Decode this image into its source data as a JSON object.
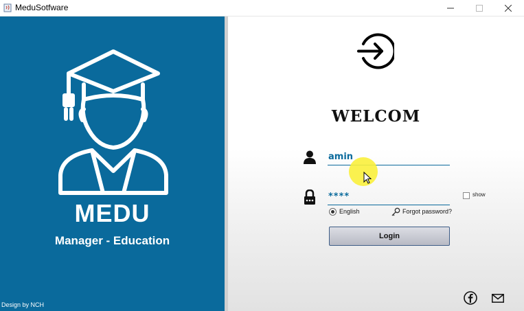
{
  "window": {
    "title": "MeduSotfware",
    "controls": [
      "minimize",
      "maximize",
      "close"
    ]
  },
  "branding": {
    "icon": "graduate-icon",
    "name": "MEDU",
    "tagline": "Manager - Education",
    "credit": "Design by NCH"
  },
  "login": {
    "header_icon": "login-arrow-icon",
    "welcome": "WELCOM",
    "username_value": "amin",
    "password_value": "****",
    "show_label": "show",
    "language_label": "English",
    "forgot_label": "Forgot password?",
    "login_label": "Login"
  },
  "footer_icons": [
    "facebook-icon",
    "mail-icon"
  ],
  "colors": {
    "brand_blue": "#0a6a9c",
    "button_border": "#3d5c86"
  }
}
